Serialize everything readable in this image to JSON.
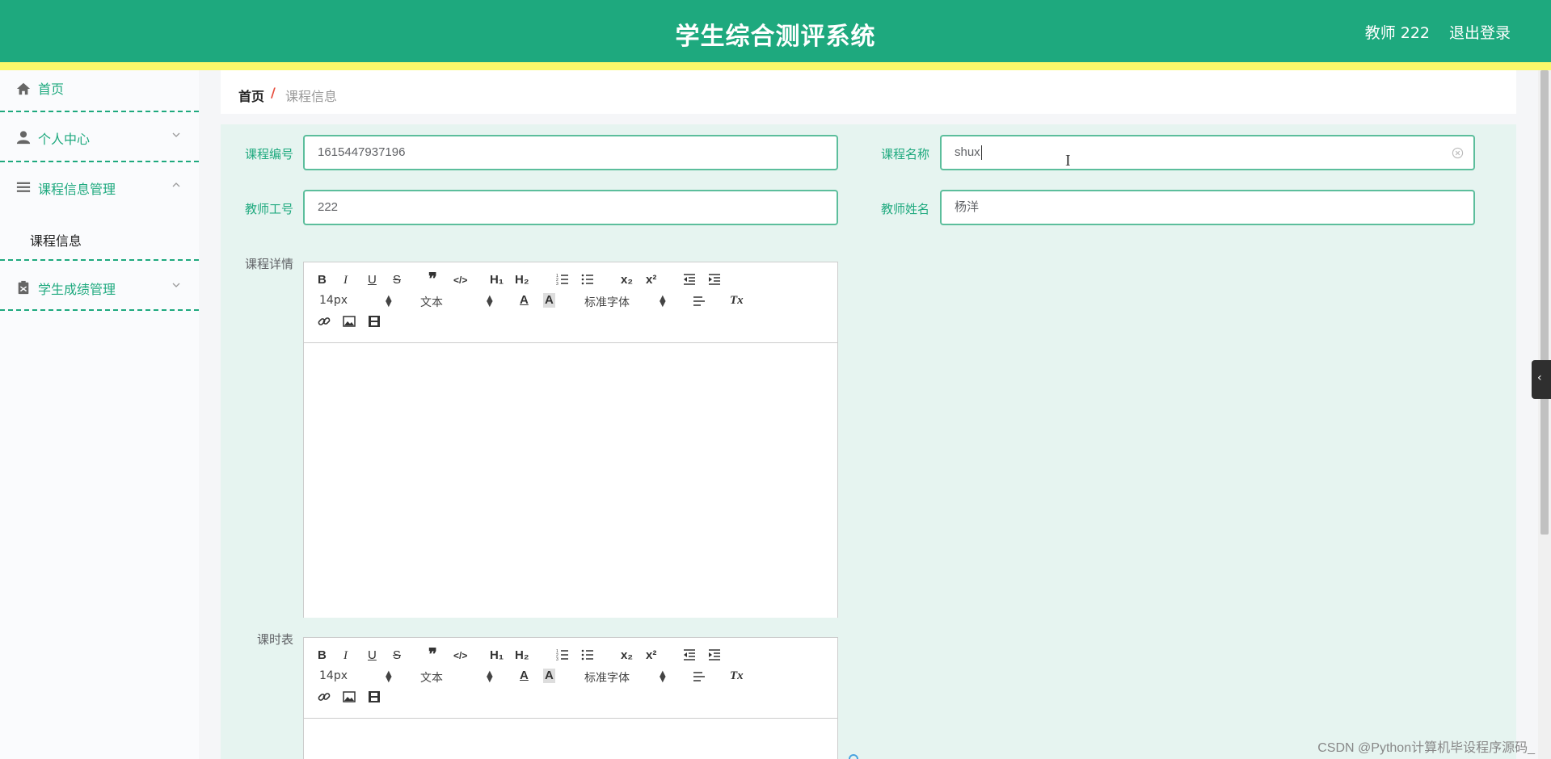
{
  "header": {
    "title": "学生综合测评系统",
    "user": "教师 222",
    "logout": "退出登录",
    "color": "#1ea97e",
    "stripe_color": "#fbf86a"
  },
  "sidebar": {
    "items": [
      {
        "label": "首页",
        "icon": "home-icon"
      },
      {
        "label": "个人中心",
        "icon": "user-icon"
      },
      {
        "label": "课程信息管理",
        "icon": "list-icon",
        "expanded": true,
        "children": [
          {
            "label": "课程信息"
          }
        ]
      },
      {
        "label": "学生成绩管理",
        "icon": "clipboard-icon"
      }
    ]
  },
  "breadcrumb": {
    "home": "首页",
    "separator": "/",
    "current": "课程信息"
  },
  "form": {
    "course_id": {
      "label": "课程编号",
      "value": "1615447937196"
    },
    "course_name": {
      "label": "课程名称",
      "value": "shux"
    },
    "teacher_id": {
      "label": "教师工号",
      "value": "222"
    },
    "teacher_name": {
      "label": "教师姓名",
      "value": "杨洋"
    },
    "course_detail": {
      "label": "课程详情"
    },
    "schedule": {
      "label": "课时表"
    }
  },
  "editor": {
    "font_size": "14px",
    "paragraph": "文本",
    "font_family": "标准字体",
    "buttons": {
      "bold": "B",
      "italic": "I",
      "underline": "U",
      "strike": "S",
      "h1": "H₁",
      "h2": "H₂",
      "sub": "x₂",
      "sup": "x²",
      "clear": "Tx"
    }
  },
  "watermark": "CSDN @Python计算机毕设程序源码_"
}
